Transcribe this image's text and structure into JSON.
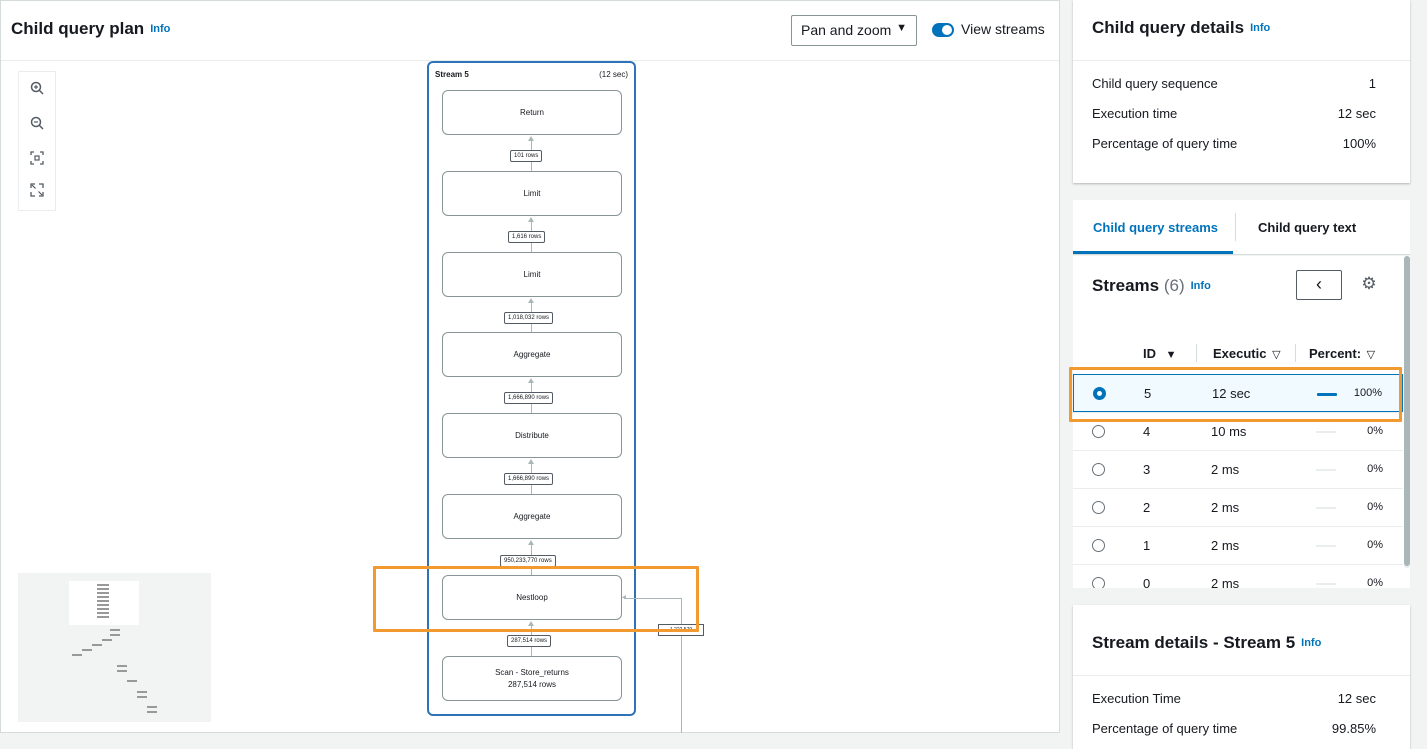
{
  "plan": {
    "title": "Child query plan",
    "info": "Info",
    "view_mode": "Pan and zoom",
    "view_streams_label": "View streams",
    "view_streams_enabled": true,
    "stream": {
      "title": "Stream 5",
      "time": "(12 sec)"
    },
    "nodes": [
      {
        "label": "Return",
        "sub": ""
      },
      {
        "label": "Limit",
        "sub": ""
      },
      {
        "label": "Limit",
        "sub": ""
      },
      {
        "label": "Aggregate",
        "sub": ""
      },
      {
        "label": "Distribute",
        "sub": ""
      },
      {
        "label": "Aggregate",
        "sub": ""
      },
      {
        "label": "Nestloop",
        "sub": ""
      },
      {
        "label": "Scan - Store_returns",
        "sub": "287,514 rows"
      }
    ],
    "edges": [
      "101 rows",
      "1,616 rows",
      "1,018,032 rows",
      "1,666,890 rows",
      "1,666,890 rows",
      "950,233,770 rows",
      "287,514 rows"
    ],
    "side_edge_label": "1,222,579",
    "zoom_icons": [
      "zoom-in-icon",
      "zoom-out-icon",
      "fit-to-screen-icon",
      "fullscreen-icon"
    ],
    "highlight_color": "#f29a2f"
  },
  "details": {
    "title": "Child query details",
    "info": "Info",
    "rows": [
      {
        "label": "Child query sequence",
        "value": "1"
      },
      {
        "label": "Execution time",
        "value": "12 sec"
      },
      {
        "label": "Percentage of query time",
        "value": "100%"
      }
    ]
  },
  "tabs": [
    {
      "label": "Child query streams",
      "active": true
    },
    {
      "label": "Child query text",
      "active": false
    }
  ],
  "streams": {
    "title": "Streams",
    "count": "(6)",
    "info": "Info",
    "columns": [
      "ID",
      "Executic",
      "Percent:"
    ],
    "sort_icons": [
      "▼",
      "▽",
      "▽"
    ],
    "rows": [
      {
        "id": "5",
        "exec": "12 sec",
        "pct": "100%",
        "fraction": 1.0,
        "selected": true
      },
      {
        "id": "4",
        "exec": "10 ms",
        "pct": "0%",
        "fraction": 0,
        "selected": false
      },
      {
        "id": "3",
        "exec": "2 ms",
        "pct": "0%",
        "fraction": 0,
        "selected": false
      },
      {
        "id": "2",
        "exec": "2 ms",
        "pct": "0%",
        "fraction": 0,
        "selected": false
      },
      {
        "id": "1",
        "exec": "2 ms",
        "pct": "0%",
        "fraction": 0,
        "selected": false
      },
      {
        "id": "0",
        "exec": "2 ms",
        "pct": "0%",
        "fraction": 0,
        "selected": false
      }
    ]
  },
  "stream_details": {
    "title": "Stream details - Stream 5",
    "info": "Info",
    "rows": [
      {
        "label": "Execution Time",
        "value": "12 sec"
      },
      {
        "label": "Percentage of query time",
        "value": "99.85%"
      }
    ]
  },
  "colors": {
    "accent": "#0073bb",
    "highlight": "#f29a2f"
  }
}
